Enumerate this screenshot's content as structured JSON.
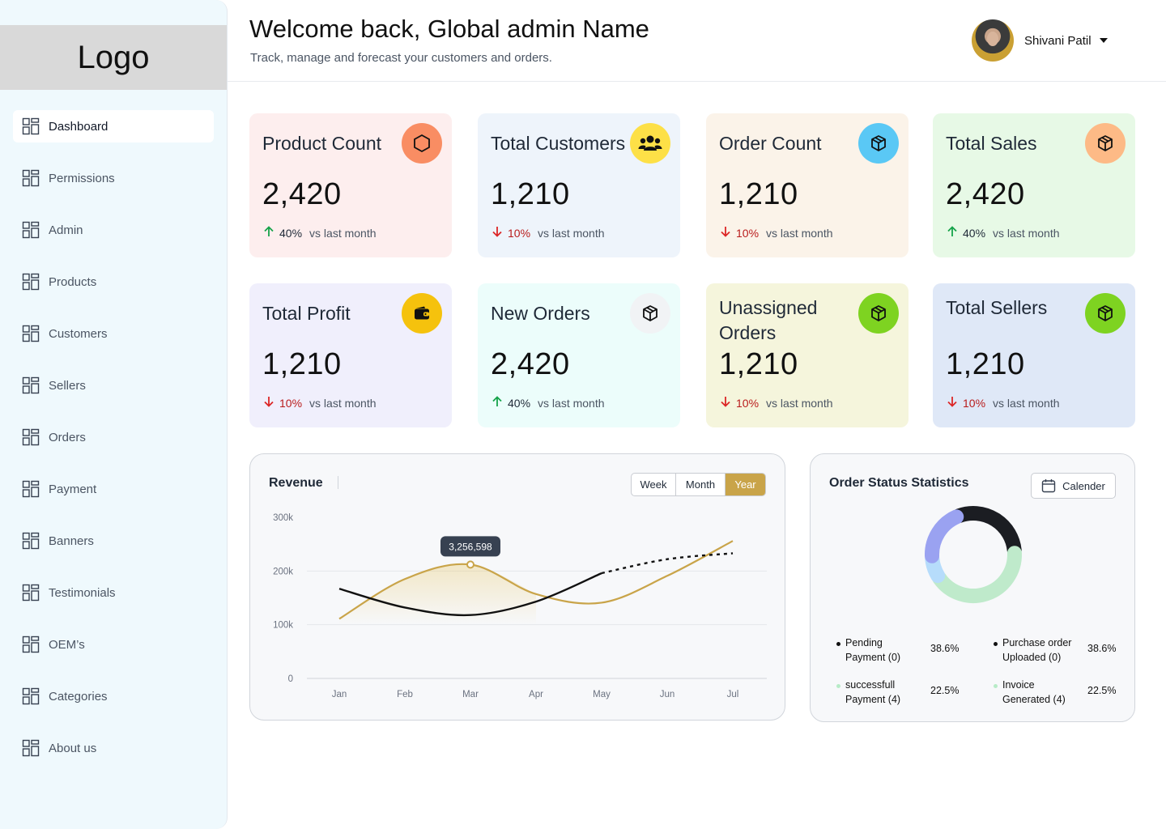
{
  "sidebar": {
    "logo": "Logo",
    "items": [
      {
        "label": "Dashboard",
        "active": true
      },
      {
        "label": "Permissions"
      },
      {
        "label": "Admin"
      },
      {
        "label": "Products"
      },
      {
        "label": "Customers"
      },
      {
        "label": "Sellers"
      },
      {
        "label": "Orders"
      },
      {
        "label": "Payment"
      },
      {
        "label": "Banners"
      },
      {
        "label": "Testimonials"
      },
      {
        "label": "OEM’s"
      },
      {
        "label": "Categories"
      },
      {
        "label": "About us"
      }
    ],
    "item_icon": "grid-icon"
  },
  "header": {
    "welcome": "Welcome back, Global admin Name",
    "subtitle": "Track, manage and forecast your customers and orders.",
    "user_name": "Shivani Patil"
  },
  "cards": [
    {
      "title": "Product Count",
      "value": "2,420",
      "trend": "up",
      "pct": "40%",
      "compare": "vs last month",
      "bg": "#fdeeee",
      "icon_bg": "#f98d63",
      "icon": "hexagon-icon"
    },
    {
      "title": "Total Customers",
      "value": "1,210",
      "trend": "down",
      "pct": "10%",
      "compare": "vs last month",
      "bg": "#eef4fb",
      "icon_bg": "#fde047",
      "icon": "users-icon"
    },
    {
      "title": "Order Count",
      "value": "1,210",
      "trend": "down",
      "pct": "10%",
      "compare": "vs last month",
      "bg": "#fbf3e9",
      "icon_bg": "#5ac8f5",
      "icon": "box-icon"
    },
    {
      "title": "Total Sales",
      "value": "2,420",
      "trend": "up",
      "pct": "40%",
      "compare": "vs last month",
      "bg": "#e7f9e6",
      "icon_bg": "#fdba86",
      "icon": "box-icon"
    },
    {
      "title": "Total Profit",
      "value": "1,210",
      "trend": "down",
      "pct": "10%",
      "compare": "vs last month",
      "bg": "#f0effc",
      "icon_bg": "#f5c20d",
      "icon": "wallet-icon"
    },
    {
      "title": "New Orders",
      "value": "2,420",
      "trend": "up",
      "pct": "40%",
      "compare": "vs last month",
      "bg": "#ecfdfb",
      "icon_bg": "#f1f3f5",
      "icon": "box-icon"
    },
    {
      "title": "Unassigned Orders",
      "value": "1,210",
      "trend": "down",
      "pct": "10%",
      "compare": "vs last month",
      "bg": "#f5f5dc",
      "icon_bg": "#7ed321",
      "icon": "box-icon"
    },
    {
      "title": "Total Sellers",
      "value": "1,210",
      "trend": "down",
      "pct": "10%",
      "compare": "vs last month",
      "bg": "#dfe8f7",
      "icon_bg": "#7ed321",
      "icon": "box-icon"
    }
  ],
  "colors": {
    "up": "#16a34a",
    "down": "#dc2626",
    "accent": "#c9a449"
  },
  "revenue": {
    "title": "Revenue",
    "ranges": [
      "Week",
      "Month",
      "Year"
    ],
    "active_range": "Year"
  },
  "chart_data": {
    "type": "line",
    "title": "Revenue",
    "categories": [
      "Jan",
      "Feb",
      "Mar",
      "Apr",
      "May",
      "Jun",
      "Jul"
    ],
    "y_ticks": [
      "300k",
      "200k",
      "100k",
      "0"
    ],
    "ylim": [
      0,
      300000
    ],
    "grid": true,
    "series": [
      {
        "color": "#c9a449",
        "values": [
          111000,
          185000,
          212000,
          157000,
          141000,
          191000,
          256000
        ]
      },
      {
        "color": "#111111",
        "values": [
          167000,
          132000,
          118000,
          143000,
          196000,
          222000,
          233000
        ],
        "dashed_from_index": 4
      }
    ],
    "tooltip": {
      "category": "Mar",
      "label": "3,256,598"
    }
  },
  "order_status": {
    "title": "Order Status Statistics",
    "calendar_label": "Calender",
    "items": [
      {
        "label": "Pending Payment (0)",
        "pct": "38.6%",
        "color": "#111111"
      },
      {
        "label": "Purchase order Uploaded (0)",
        "pct": "38.6%",
        "color": "#111111"
      },
      {
        "label": "successfull Payment  (4)",
        "pct": "22.5%",
        "color": "#b7ebc7"
      },
      {
        "label": "Invoice Generated (4)",
        "pct": "22.5%",
        "color": "#b7ebc7"
      }
    ],
    "donut": [
      {
        "value": 30,
        "color": "#1b1d22"
      },
      {
        "value": 42,
        "color": "#bfeacb"
      },
      {
        "value": 8,
        "color": "#b6dcfb"
      },
      {
        "value": 20,
        "color": "#9aa2f1"
      }
    ]
  }
}
